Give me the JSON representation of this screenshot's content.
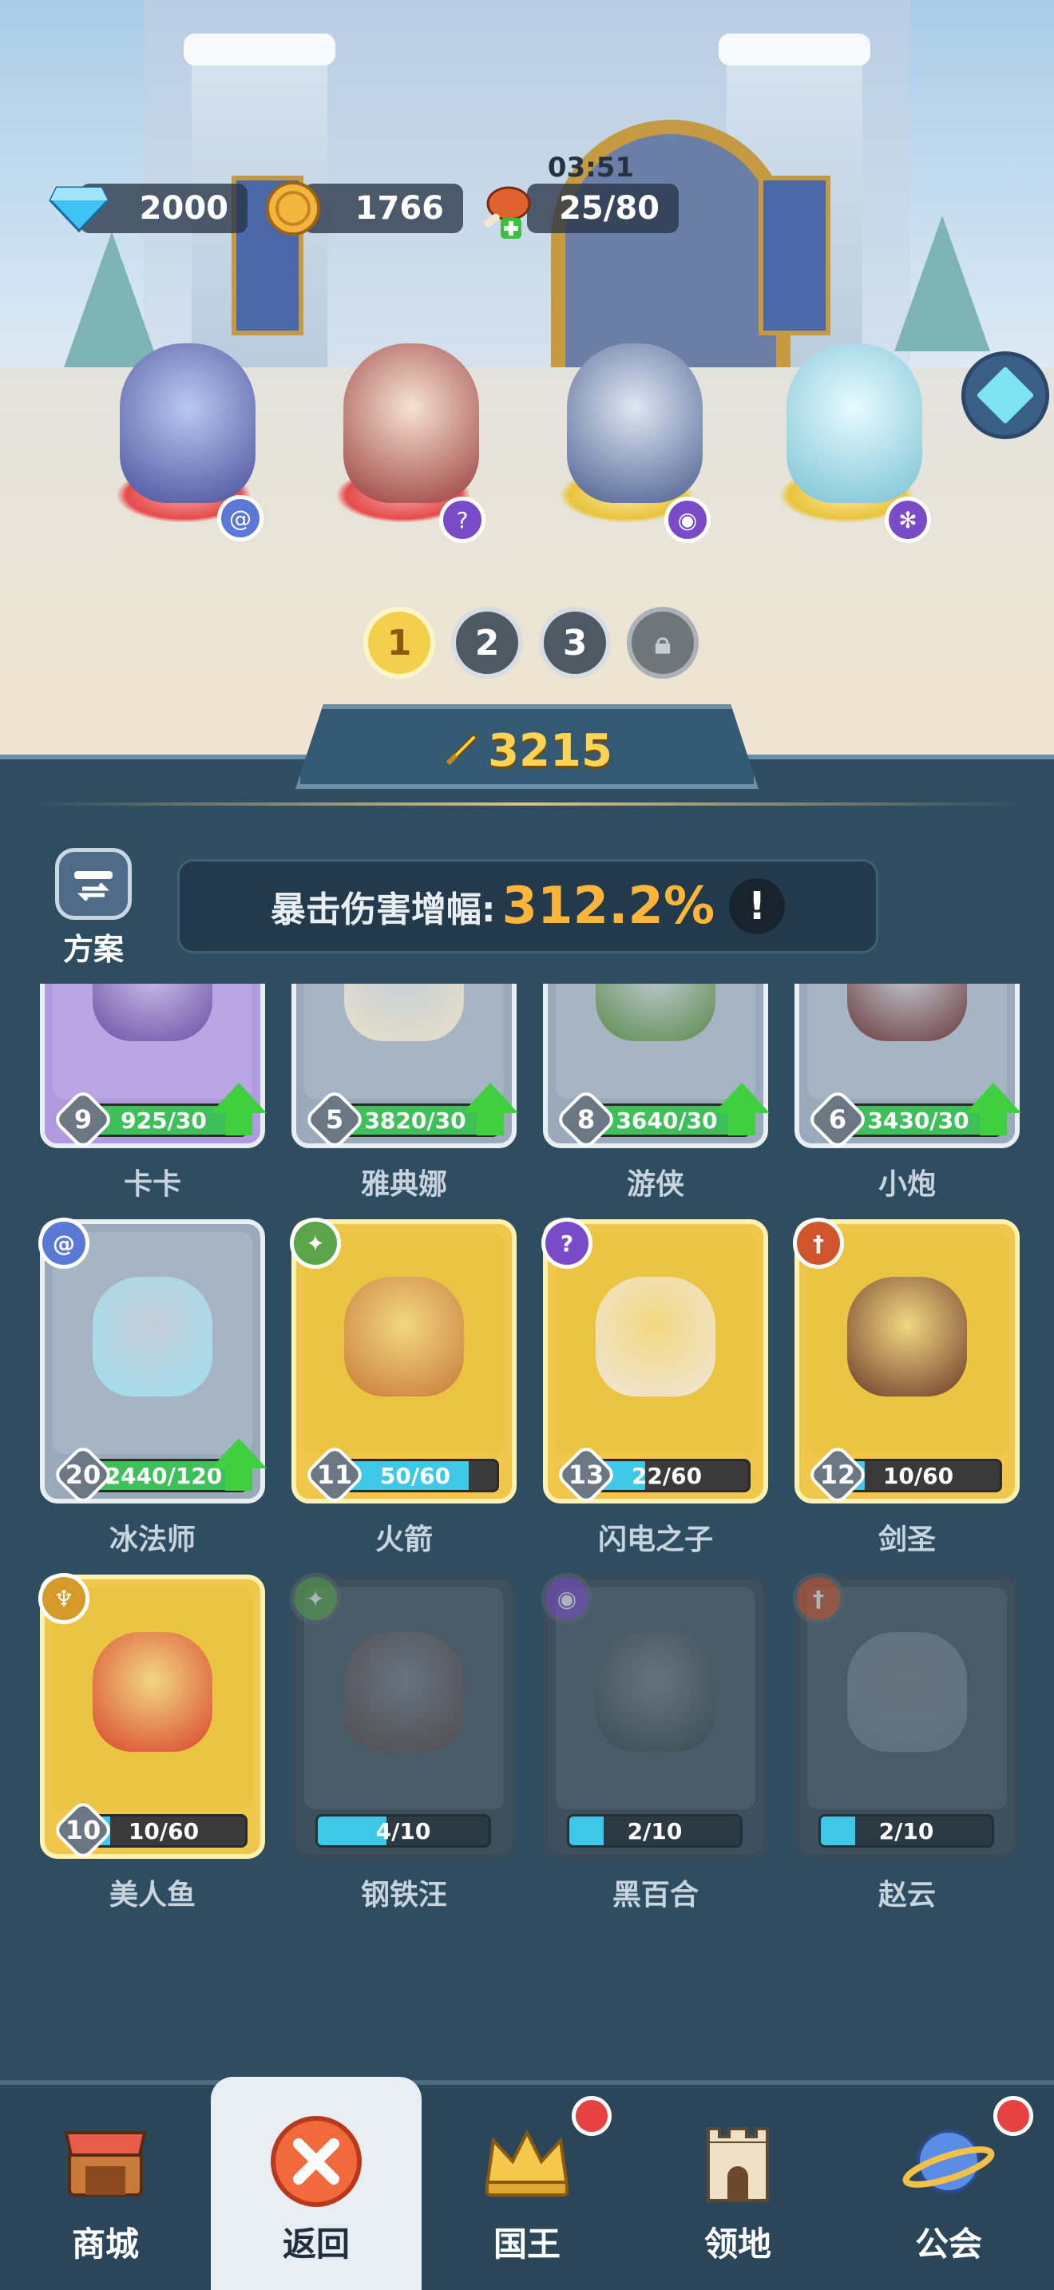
{
  "resources": {
    "gems": "2000",
    "coins": "1766",
    "stamina": "25/80",
    "stamina_timer": "03:51"
  },
  "lineup_tabs": [
    "1",
    "2",
    "3"
  ],
  "power": "3215",
  "scheme_label": "方案",
  "crit": {
    "label": "暴击伤害增幅:",
    "value": "312.2%",
    "info": "!"
  },
  "heroes": [
    {
      "name": "卡卡",
      "level": "9",
      "progress_text": "925/30",
      "progress": 1.0,
      "upgradable": true,
      "rarity": "purple",
      "class_icon": "spiral-icon",
      "class_color": "#5b78d6",
      "locked": false
    },
    {
      "name": "雅典娜",
      "level": "5",
      "progress_text": "3820/30",
      "progress": 1.0,
      "upgradable": true,
      "rarity": "grey",
      "class_icon": "question-icon",
      "class_color": "#7a4bc9",
      "locked": false
    },
    {
      "name": "游侠",
      "level": "8",
      "progress_text": "3640/30",
      "progress": 1.0,
      "upgradable": true,
      "rarity": "grey",
      "class_icon": "bow-icon",
      "class_color": "#4a9c4a",
      "locked": false
    },
    {
      "name": "小炮",
      "level": "6",
      "progress_text": "3430/30",
      "progress": 1.0,
      "upgradable": true,
      "rarity": "grey",
      "class_icon": "bomb-icon",
      "class_color": "#c44a2a",
      "locked": false
    },
    {
      "name": "冰法师",
      "level": "20",
      "progress_text": "2440/120",
      "progress": 1.0,
      "upgradable": true,
      "rarity": "grey",
      "class_icon": "spiral-icon",
      "class_color": "#5b78d6",
      "locked": false
    },
    {
      "name": "火箭",
      "level": "11",
      "progress_text": "50/60",
      "progress": 0.83,
      "upgradable": false,
      "rarity": "gold",
      "class_icon": "star-shape-icon",
      "class_color": "#5aa54a",
      "locked": false
    },
    {
      "name": "闪电之子",
      "level": "13",
      "progress_text": "22/60",
      "progress": 0.37,
      "upgradable": false,
      "rarity": "gold",
      "class_icon": "question-icon",
      "class_color": "#7a4bc9",
      "locked": false
    },
    {
      "name": "剑圣",
      "level": "12",
      "progress_text": "10/60",
      "progress": 0.17,
      "upgradable": false,
      "rarity": "gold",
      "class_icon": "sword-icon",
      "class_color": "#d0542c",
      "locked": false
    },
    {
      "name": "美人鱼",
      "level": "10",
      "progress_text": "10/60",
      "progress": 0.17,
      "upgradable": false,
      "rarity": "gold",
      "class_icon": "wing-icon",
      "class_color": "#d59a2a",
      "locked": false
    },
    {
      "name": "钢铁汪",
      "level": "",
      "progress_text": "4/10",
      "progress": 0.4,
      "upgradable": false,
      "rarity": "locked",
      "class_icon": "star-shape-icon",
      "class_color": "#5aa54a",
      "locked": true
    },
    {
      "name": "黑百合",
      "level": "",
      "progress_text": "2/10",
      "progress": 0.2,
      "upgradable": false,
      "rarity": "locked",
      "class_icon": "eye-icon",
      "class_color": "#7a4bc9",
      "locked": true
    },
    {
      "name": "赵云",
      "level": "",
      "progress_text": "2/10",
      "progress": 0.2,
      "upgradable": false,
      "rarity": "locked",
      "class_icon": "sword-icon",
      "class_color": "#d0542c",
      "locked": true
    }
  ],
  "nav": [
    {
      "label": "商城",
      "icon": "shop-icon",
      "active": false,
      "dot": false
    },
    {
      "label": "返回",
      "icon": "close-icon",
      "active": true,
      "dot": false
    },
    {
      "label": "国王",
      "icon": "crown-icon",
      "active": false,
      "dot": true
    },
    {
      "label": "领地",
      "icon": "castle-icon",
      "active": false,
      "dot": false
    },
    {
      "label": "公会",
      "icon": "planet-icon",
      "active": false,
      "dot": true
    }
  ],
  "colors": {
    "accent_gold": "#ffd454",
    "crit_value": "#ffb53a",
    "panel": "#2f4d61",
    "nav_bg": "#2b4559",
    "red_dot": "#e84141"
  }
}
